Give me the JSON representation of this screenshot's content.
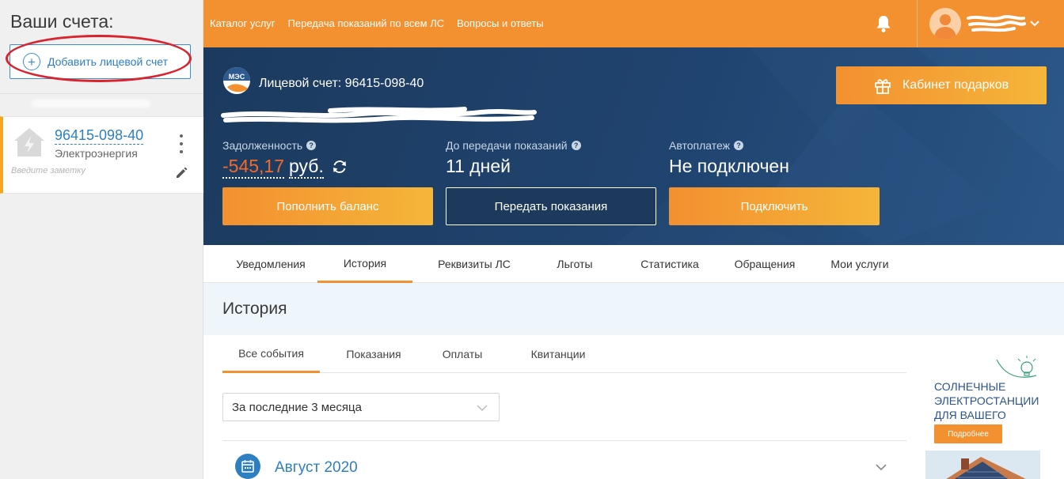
{
  "sidebar": {
    "title": "Ваши счета:",
    "add_account_label": "Добавить лицевой счет",
    "account": {
      "number": "96415-098-40",
      "type": "Электроэнергия",
      "note_placeholder": "Введите заметку"
    }
  },
  "topnav": {
    "items": [
      "Каталог услуг",
      "Передача показаний по всем ЛС",
      "Вопросы и ответы"
    ]
  },
  "hero": {
    "logo_text": "МЭС",
    "account_title": "Лицевой счет: 96415-098-40",
    "gift_label": "Кабинет подарков",
    "debt_label": "Задолженность",
    "debt_amount": "-545,17",
    "debt_currency": "руб.",
    "meter_label": "До передачи показаний",
    "meter_value": "11 дней",
    "autopay_label": "Автоплатеж",
    "autopay_value": "Не подключен",
    "topup_label": "Пополнить баланс",
    "submit_label": "Передать показания",
    "connect_label": "Подключить"
  },
  "tabs": [
    "Уведомления",
    "История",
    "Реквизиты ЛС",
    "Льготы",
    "Статистика",
    "Обращения",
    "Мои услуги"
  ],
  "active_tab": "История",
  "history": {
    "title": "История",
    "subtabs": [
      "Все события",
      "Показания",
      "Оплаты",
      "Квитанции"
    ],
    "active_subtab": "Все события",
    "period_value": "За последние 3 месяца",
    "month_label": "Август 2020"
  },
  "ad": {
    "text": "Солнечные электростанции для вашего дома",
    "button_label": "Подробнее"
  },
  "colors": {
    "accent_orange": "#f39030",
    "link_blue": "#2d7fc1",
    "hero_navy": "#1c3a5e",
    "debt_red": "#f26a2e",
    "annotation_red": "#d9232e"
  }
}
